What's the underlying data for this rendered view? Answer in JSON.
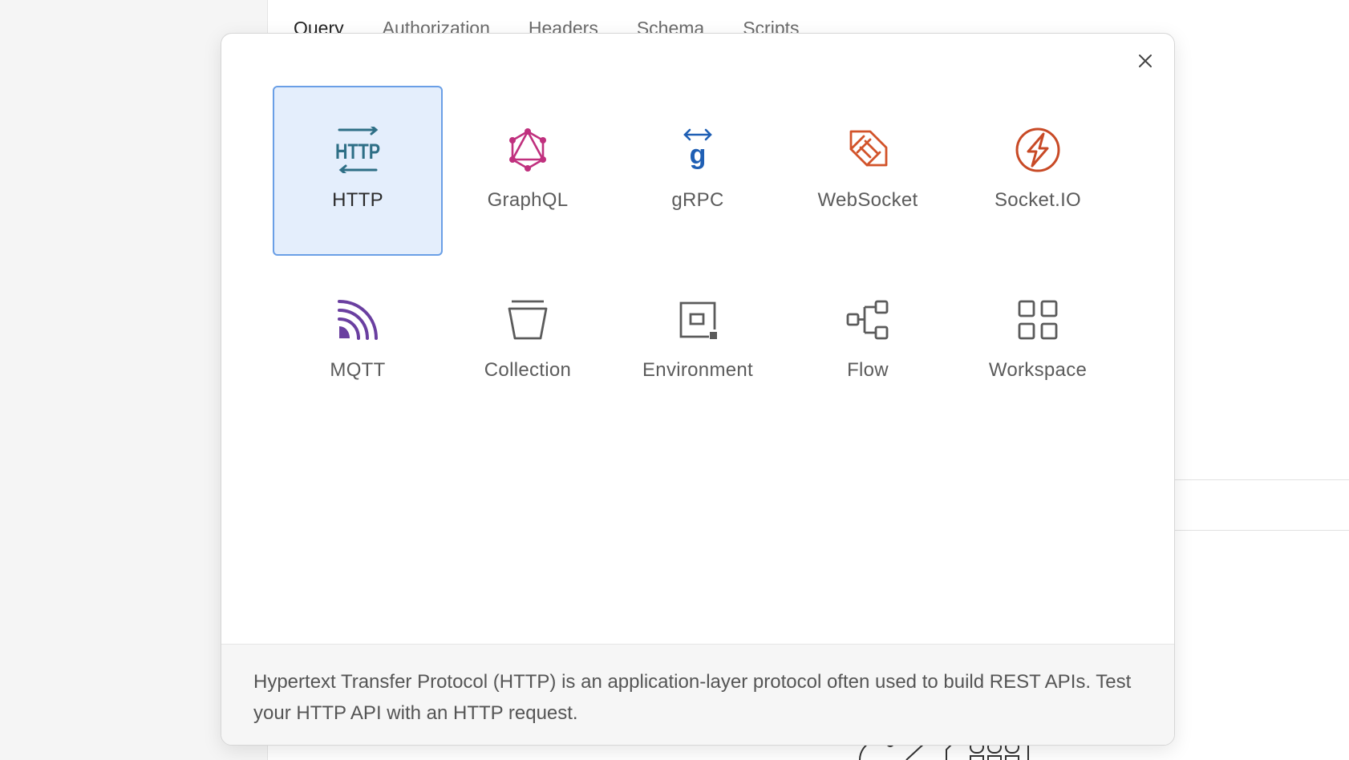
{
  "background": {
    "tabs": [
      "Query",
      "Authorization",
      "Headers",
      "Schema",
      "Scripts"
    ]
  },
  "modal": {
    "close_icon": "close-icon",
    "items": [
      {
        "label": "HTTP",
        "icon": "http-icon",
        "color": "#2e6f86",
        "selected": true
      },
      {
        "label": "GraphQL",
        "icon": "graphql-icon",
        "color": "#c0307e"
      },
      {
        "label": "gRPC",
        "icon": "grpc-icon",
        "color": "#1f5fb4"
      },
      {
        "label": "WebSocket",
        "icon": "websocket-icon",
        "color": "#d2532a"
      },
      {
        "label": "Socket.IO",
        "icon": "socketio-icon",
        "color": "#c84a26"
      },
      {
        "label": "MQTT",
        "icon": "mqtt-icon",
        "color": "#6a3fa0"
      },
      {
        "label": "Collection",
        "icon": "collection-icon",
        "color": "#5b5b5b"
      },
      {
        "label": "Environment",
        "icon": "environment-icon",
        "color": "#5b5b5b"
      },
      {
        "label": "Flow",
        "icon": "flow-icon",
        "color": "#5b5b5b"
      },
      {
        "label": "Workspace",
        "icon": "workspace-icon",
        "color": "#5b5b5b"
      }
    ],
    "description": "Hypertext Transfer Protocol (HTTP) is an application-layer protocol often used to build REST APIs. Test your HTTP API with an HTTP request."
  }
}
